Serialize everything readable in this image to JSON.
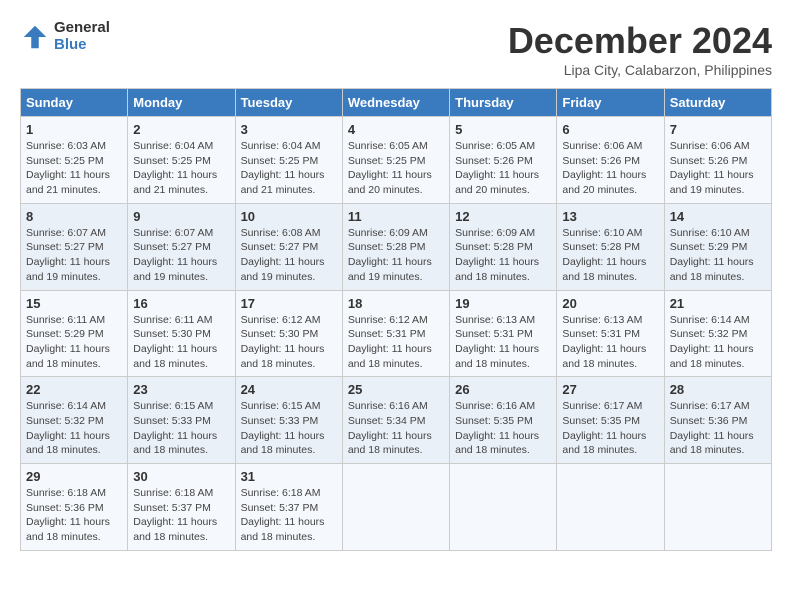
{
  "logo": {
    "general": "General",
    "blue": "Blue"
  },
  "title": "December 2024",
  "location": "Lipa City, Calabarzon, Philippines",
  "headers": [
    "Sunday",
    "Monday",
    "Tuesday",
    "Wednesday",
    "Thursday",
    "Friday",
    "Saturday"
  ],
  "weeks": [
    [
      {
        "day": "1",
        "sunrise": "6:03 AM",
        "sunset": "5:25 PM",
        "daylight": "11 hours and 21 minutes."
      },
      {
        "day": "2",
        "sunrise": "6:04 AM",
        "sunset": "5:25 PM",
        "daylight": "11 hours and 21 minutes."
      },
      {
        "day": "3",
        "sunrise": "6:04 AM",
        "sunset": "5:25 PM",
        "daylight": "11 hours and 21 minutes."
      },
      {
        "day": "4",
        "sunrise": "6:05 AM",
        "sunset": "5:25 PM",
        "daylight": "11 hours and 20 minutes."
      },
      {
        "day": "5",
        "sunrise": "6:05 AM",
        "sunset": "5:26 PM",
        "daylight": "11 hours and 20 minutes."
      },
      {
        "day": "6",
        "sunrise": "6:06 AM",
        "sunset": "5:26 PM",
        "daylight": "11 hours and 20 minutes."
      },
      {
        "day": "7",
        "sunrise": "6:06 AM",
        "sunset": "5:26 PM",
        "daylight": "11 hours and 19 minutes."
      }
    ],
    [
      {
        "day": "8",
        "sunrise": "6:07 AM",
        "sunset": "5:27 PM",
        "daylight": "11 hours and 19 minutes."
      },
      {
        "day": "9",
        "sunrise": "6:07 AM",
        "sunset": "5:27 PM",
        "daylight": "11 hours and 19 minutes."
      },
      {
        "day": "10",
        "sunrise": "6:08 AM",
        "sunset": "5:27 PM",
        "daylight": "11 hours and 19 minutes."
      },
      {
        "day": "11",
        "sunrise": "6:09 AM",
        "sunset": "5:28 PM",
        "daylight": "11 hours and 19 minutes."
      },
      {
        "day": "12",
        "sunrise": "6:09 AM",
        "sunset": "5:28 PM",
        "daylight": "11 hours and 18 minutes."
      },
      {
        "day": "13",
        "sunrise": "6:10 AM",
        "sunset": "5:28 PM",
        "daylight": "11 hours and 18 minutes."
      },
      {
        "day": "14",
        "sunrise": "6:10 AM",
        "sunset": "5:29 PM",
        "daylight": "11 hours and 18 minutes."
      }
    ],
    [
      {
        "day": "15",
        "sunrise": "6:11 AM",
        "sunset": "5:29 PM",
        "daylight": "11 hours and 18 minutes."
      },
      {
        "day": "16",
        "sunrise": "6:11 AM",
        "sunset": "5:30 PM",
        "daylight": "11 hours and 18 minutes."
      },
      {
        "day": "17",
        "sunrise": "6:12 AM",
        "sunset": "5:30 PM",
        "daylight": "11 hours and 18 minutes."
      },
      {
        "day": "18",
        "sunrise": "6:12 AM",
        "sunset": "5:31 PM",
        "daylight": "11 hours and 18 minutes."
      },
      {
        "day": "19",
        "sunrise": "6:13 AM",
        "sunset": "5:31 PM",
        "daylight": "11 hours and 18 minutes."
      },
      {
        "day": "20",
        "sunrise": "6:13 AM",
        "sunset": "5:31 PM",
        "daylight": "11 hours and 18 minutes."
      },
      {
        "day": "21",
        "sunrise": "6:14 AM",
        "sunset": "5:32 PM",
        "daylight": "11 hours and 18 minutes."
      }
    ],
    [
      {
        "day": "22",
        "sunrise": "6:14 AM",
        "sunset": "5:32 PM",
        "daylight": "11 hours and 18 minutes."
      },
      {
        "day": "23",
        "sunrise": "6:15 AM",
        "sunset": "5:33 PM",
        "daylight": "11 hours and 18 minutes."
      },
      {
        "day": "24",
        "sunrise": "6:15 AM",
        "sunset": "5:33 PM",
        "daylight": "11 hours and 18 minutes."
      },
      {
        "day": "25",
        "sunrise": "6:16 AM",
        "sunset": "5:34 PM",
        "daylight": "11 hours and 18 minutes."
      },
      {
        "day": "26",
        "sunrise": "6:16 AM",
        "sunset": "5:35 PM",
        "daylight": "11 hours and 18 minutes."
      },
      {
        "day": "27",
        "sunrise": "6:17 AM",
        "sunset": "5:35 PM",
        "daylight": "11 hours and 18 minutes."
      },
      {
        "day": "28",
        "sunrise": "6:17 AM",
        "sunset": "5:36 PM",
        "daylight": "11 hours and 18 minutes."
      }
    ],
    [
      {
        "day": "29",
        "sunrise": "6:18 AM",
        "sunset": "5:36 PM",
        "daylight": "11 hours and 18 minutes."
      },
      {
        "day": "30",
        "sunrise": "6:18 AM",
        "sunset": "5:37 PM",
        "daylight": "11 hours and 18 minutes."
      },
      {
        "day": "31",
        "sunrise": "6:18 AM",
        "sunset": "5:37 PM",
        "daylight": "11 hours and 18 minutes."
      },
      null,
      null,
      null,
      null
    ]
  ],
  "labels": {
    "sunrise": "Sunrise:",
    "sunset": "Sunset:",
    "daylight": "Daylight:"
  }
}
